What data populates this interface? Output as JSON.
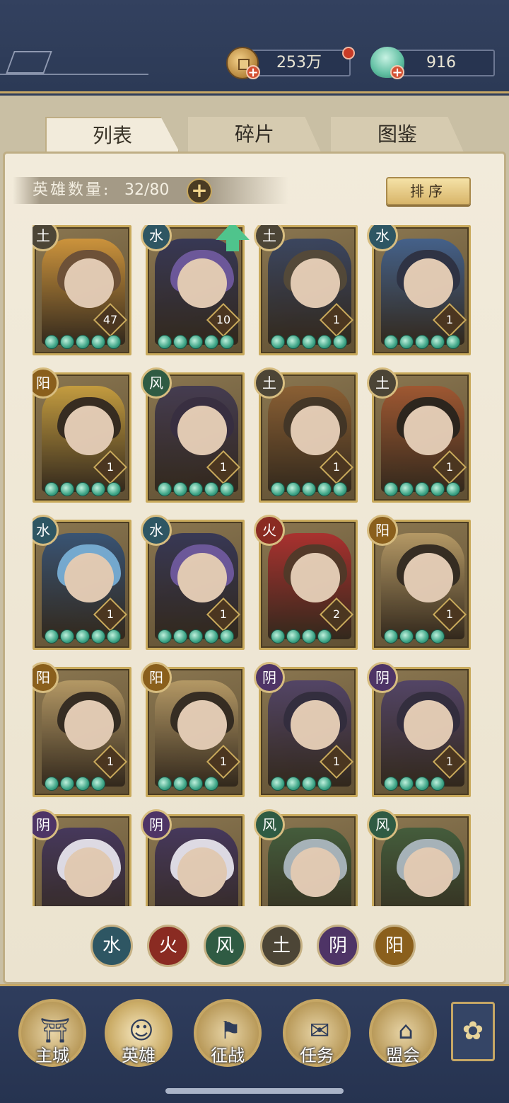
{
  "currency": {
    "coins": "253万",
    "jade": "916",
    "add": "+"
  },
  "tabs": [
    "列表",
    "碎片",
    "图鉴"
  ],
  "hero_count": {
    "label": "英雄数量:",
    "value": "32/80",
    "add": "+"
  },
  "sort_label": "排序",
  "faction_colors": {
    "水": "#2e5663",
    "火": "#8a2b22",
    "风": "#2f5b43",
    "土": "#4c4536",
    "阴": "#4e3466",
    "阳": "#8a5f1c"
  },
  "heroes": [
    {
      "faction": "土",
      "level": "47",
      "stars": 5,
      "hair": "#6b4d36",
      "bg": "#d99a3a"
    },
    {
      "faction": "水",
      "level": "10",
      "stars": 5,
      "hair": "#6a55a8",
      "bg": "#2b2f57",
      "upgrade": true
    },
    {
      "faction": "土",
      "level": "1",
      "stars": 5,
      "hair": "#4d4437",
      "bg": "#2f3f63"
    },
    {
      "faction": "水",
      "level": "1",
      "stars": 5,
      "hair": "#222a44",
      "bg": "#3a5f95"
    },
    {
      "faction": "阳",
      "level": "1",
      "stars": 5,
      "hair": "#2b221b",
      "bg": "#cfa43e"
    },
    {
      "faction": "风",
      "level": "1",
      "stars": 5,
      "hair": "#2d2540",
      "bg": "#3b3452"
    },
    {
      "faction": "土",
      "level": "1",
      "stars": 5,
      "hair": "#3a2e22",
      "bg": "#8c5d30"
    },
    {
      "faction": "土",
      "level": "1",
      "stars": 5,
      "hair": "#1f1a17",
      "bg": "#a4542e"
    },
    {
      "faction": "水",
      "level": "1",
      "stars": 5,
      "hair": "#74b4e6",
      "bg": "#2c4f7b"
    },
    {
      "faction": "水",
      "level": "1",
      "stars": 5,
      "hair": "#6a55a8",
      "bg": "#2b2f57"
    },
    {
      "faction": "火",
      "level": "2",
      "stars": 4,
      "hair": "#4b3124",
      "bg": "#b0272a"
    },
    {
      "faction": "阳",
      "level": "1",
      "stars": 4,
      "hair": "#2a231d",
      "bg": "#bda06a"
    },
    {
      "faction": "阳",
      "level": "1",
      "stars": 4,
      "hair": "#2a231d",
      "bg": "#bda06a"
    },
    {
      "faction": "阳",
      "level": "1",
      "stars": 4,
      "hair": "#2a231d",
      "bg": "#bda06a"
    },
    {
      "faction": "阴",
      "level": "1",
      "stars": 4,
      "hair": "#27243d",
      "bg": "#4b3e6b"
    },
    {
      "faction": "阴",
      "level": "1",
      "stars": 4,
      "hair": "#27243d",
      "bg": "#4b3e6b"
    },
    {
      "faction": "阴",
      "level": "",
      "stars": 0,
      "hair": "#eeeeff",
      "bg": "#3c2f5f"
    },
    {
      "faction": "阴",
      "level": "",
      "stars": 0,
      "hair": "#eeeeff",
      "bg": "#3c2f5f"
    },
    {
      "faction": "风",
      "level": "",
      "stars": 0,
      "hair": "#aebfcc",
      "bg": "#3a5a3a"
    },
    {
      "faction": "风",
      "level": "",
      "stars": 0,
      "hair": "#aebfcc",
      "bg": "#3a5a3a"
    }
  ],
  "filters": [
    "水",
    "火",
    "风",
    "土",
    "阴",
    "阳"
  ],
  "nav": [
    {
      "label": "主城",
      "icon": "palace-icon",
      "glyph": "⛩"
    },
    {
      "label": "英雄",
      "icon": "hero-avatar-icon",
      "glyph": "☺",
      "active": true
    },
    {
      "label": "征战",
      "icon": "battle-horn-icon",
      "glyph": "⚑"
    },
    {
      "label": "任务",
      "icon": "scroll-task-icon",
      "glyph": "✉"
    },
    {
      "label": "盟会",
      "icon": "alliance-gate-icon",
      "glyph": "⌂"
    }
  ],
  "more_icon": "flower-menu-icon"
}
